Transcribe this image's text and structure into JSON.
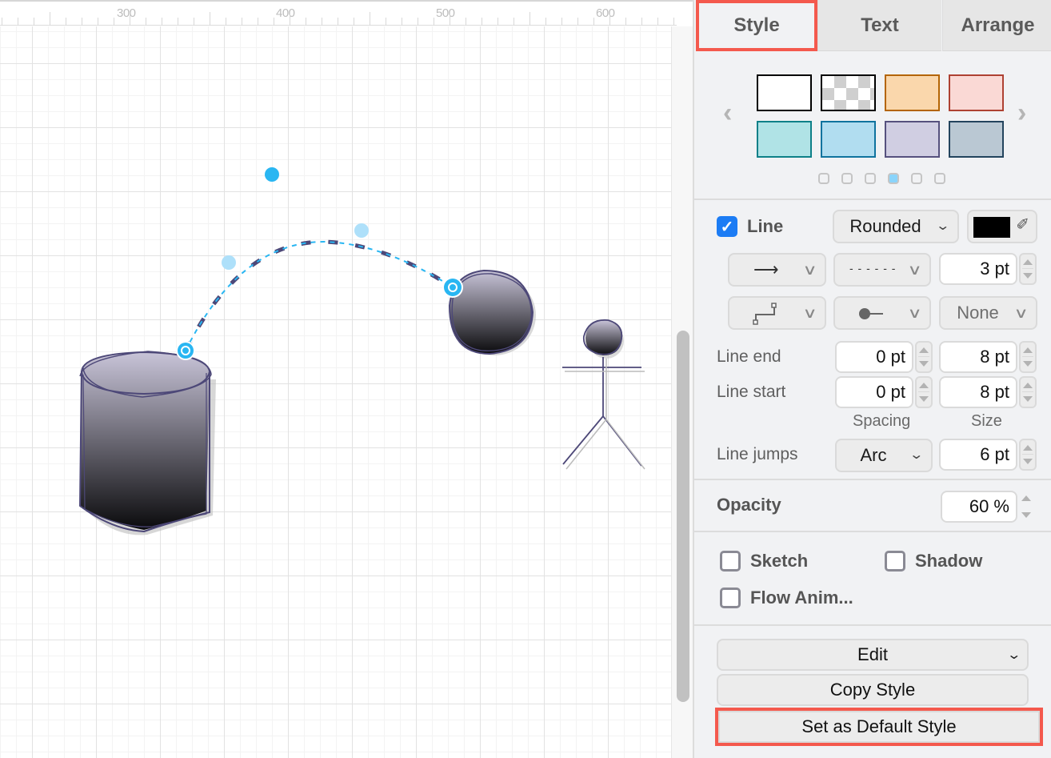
{
  "ruler": {
    "labels": [
      "300",
      "400",
      "500",
      "600"
    ]
  },
  "canvas": {
    "shapes": [
      {
        "type": "cylinder",
        "style": "sketch-gradient"
      },
      {
        "type": "ellipse",
        "style": "sketch-gradient"
      },
      {
        "type": "actor",
        "style": "sketch-gradient"
      }
    ],
    "edge": {
      "style": "curved-dashed",
      "selected": true,
      "stroke_color": "#4a4673",
      "selection_color": "#29b6f2"
    }
  },
  "panel": {
    "tabs": [
      {
        "label": "Style",
        "active": true
      },
      {
        "label": "Text",
        "active": false
      },
      {
        "label": "Arrange",
        "active": false
      }
    ],
    "swatches": {
      "prev_icon": "chevron-left-icon",
      "next_icon": "chevron-right-icon",
      "items": [
        {
          "name": "white",
          "fill": "#ffffff",
          "stroke": "#000000"
        },
        {
          "name": "transparent",
          "fill": "checker",
          "stroke": "#000000"
        },
        {
          "name": "orange",
          "fill": "#fad7ac",
          "stroke": "#b46504"
        },
        {
          "name": "red",
          "fill": "#fad9d5",
          "stroke": "#ae4132"
        },
        {
          "name": "teal",
          "fill": "#b0e3e6",
          "stroke": "#0e8088"
        },
        {
          "name": "blue",
          "fill": "#b1ddf0",
          "stroke": "#10739e"
        },
        {
          "name": "purple",
          "fill": "#d0cee2",
          "stroke": "#56517e"
        },
        {
          "name": "slate",
          "fill": "#bac8d3",
          "stroke": "#23445d"
        }
      ],
      "pages": 6,
      "active_page": 4
    },
    "line": {
      "enabled": true,
      "label": "Line",
      "style_value": "Rounded",
      "color": "#000000",
      "pattern_icon": "arrow-right-line-icon",
      "dash_value": "- - - - - -",
      "width_value": "3 pt",
      "waypoint_icon": "orthogonal-connector-icon",
      "endpoint_icon": "circle-line-end-icon",
      "end_arrow_value": "None",
      "line_end_label": "Line end",
      "line_end_spacing": "0 pt",
      "line_end_size": "8 pt",
      "line_start_label": "Line start",
      "line_start_spacing": "0 pt",
      "line_start_size": "8 pt",
      "spacing_label": "Spacing",
      "size_label": "Size",
      "line_jumps_label": "Line jumps",
      "line_jumps_value": "Arc",
      "line_jumps_size": "6 pt"
    },
    "opacity": {
      "label": "Opacity",
      "value": "60 %"
    },
    "options": {
      "sketch": {
        "label": "Sketch",
        "checked": false
      },
      "shadow": {
        "label": "Shadow",
        "checked": false
      },
      "flow_anim": {
        "label": "Flow Anim...",
        "checked": false
      }
    },
    "buttons": {
      "edit": "Edit",
      "copy_style": "Copy Style",
      "set_default": "Set as Default Style"
    },
    "highlight_color": "#f4594d"
  }
}
